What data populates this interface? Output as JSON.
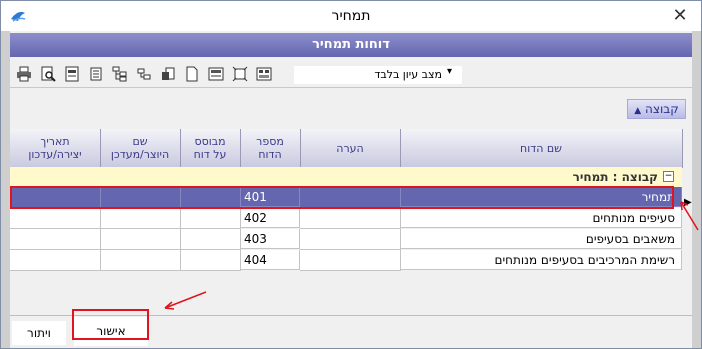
{
  "window": {
    "title": "תמחיר",
    "close_glyph": "✕",
    "header_band": "דוחות תמחיר"
  },
  "toolbar": {
    "icons": [
      "print-icon",
      "print-preview-icon",
      "export-pdf-icon",
      "report-list-icon",
      "tree-structure-icon",
      "hierarchy-icon",
      "open-file-icon",
      "new-document-icon",
      "form-icon",
      "fit-page-icon",
      "grid-settings-icon"
    ],
    "view_mode": "מצב עיון בלבד",
    "view_mode_arrow": "▾"
  },
  "group_button": {
    "label": "קבוצה",
    "icon": "▲"
  },
  "grid": {
    "columns": [
      {
        "label": "שם הדוח"
      },
      {
        "label": "הערה"
      },
      {
        "label": "מספר\nהדוח"
      },
      {
        "label": "מבוסס\nעל דוח"
      },
      {
        "label": "שם\nהיוצר/מעדכן"
      },
      {
        "label": "תאריך\nיצירה/עדכון"
      }
    ],
    "group_row": {
      "label": "קבוצה : תמחיר",
      "toggle": "−"
    },
    "rows": [
      {
        "name": "תמחיר",
        "number": "401",
        "selected": true
      },
      {
        "name": "סעיפים מנותחים",
        "number": "402",
        "selected": false
      },
      {
        "name": "משאבים בסעיפים",
        "number": "403",
        "selected": false
      },
      {
        "name": "רשימת המרכיבים בסעיפים מנותחים",
        "number": "404",
        "selected": false
      }
    ],
    "row_indicator": "▶"
  },
  "footer": {
    "ok_label": "אישור",
    "cancel_label": "ויתור"
  },
  "colors": {
    "accent": "#6466b0",
    "group_row_bg": "#fff9cc",
    "annotation_red": "#e0141e"
  }
}
